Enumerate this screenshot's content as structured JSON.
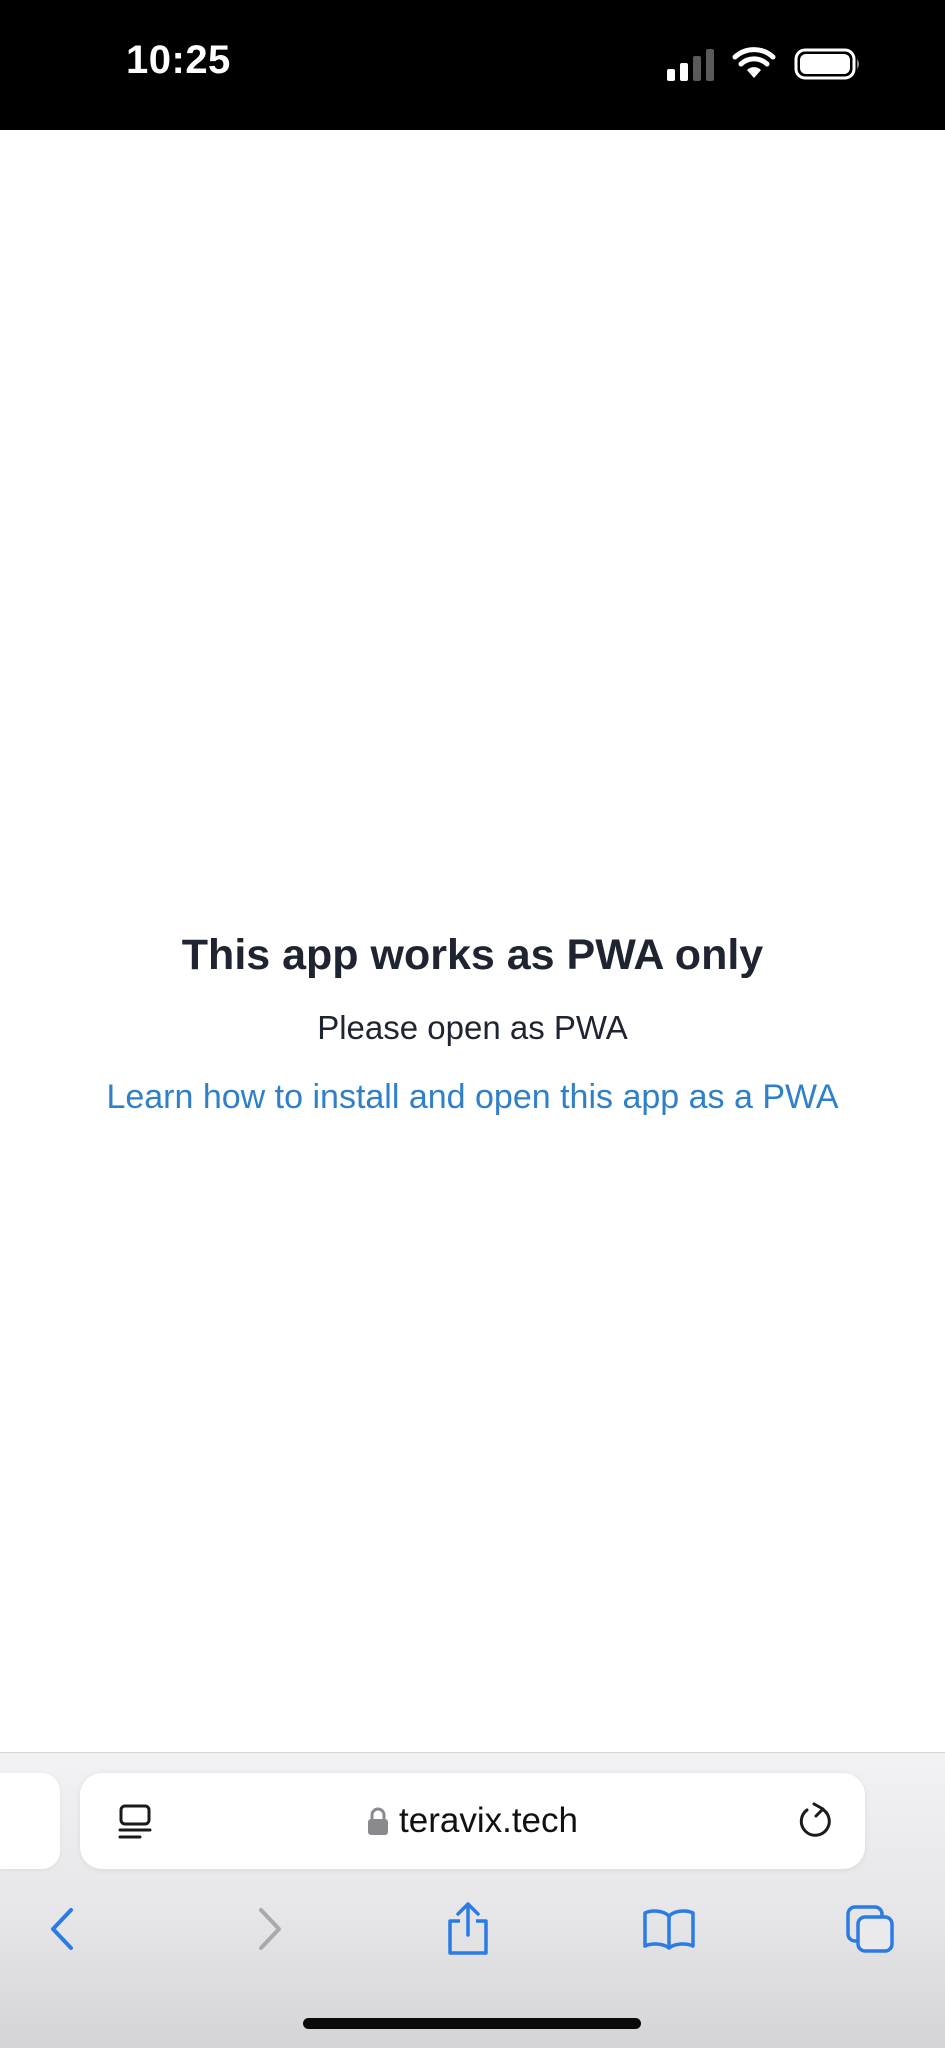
{
  "status_bar": {
    "time": "10:25"
  },
  "page": {
    "title": "This app works as PWA only",
    "subtitle": "Please open as PWA",
    "link_text": "Learn how to install and open this app as a PWA"
  },
  "browser": {
    "url": "teravix.tech"
  },
  "toolbar": {
    "icons": [
      "back-icon",
      "forward-icon",
      "share-icon",
      "bookmarks-icon",
      "tabs-icon"
    ]
  },
  "colors": {
    "accent": "#2f80c8",
    "toolbar_active": "#2a7be4",
    "toolbar_disabled": "#a8a8ad",
    "text": "#1e2430"
  }
}
